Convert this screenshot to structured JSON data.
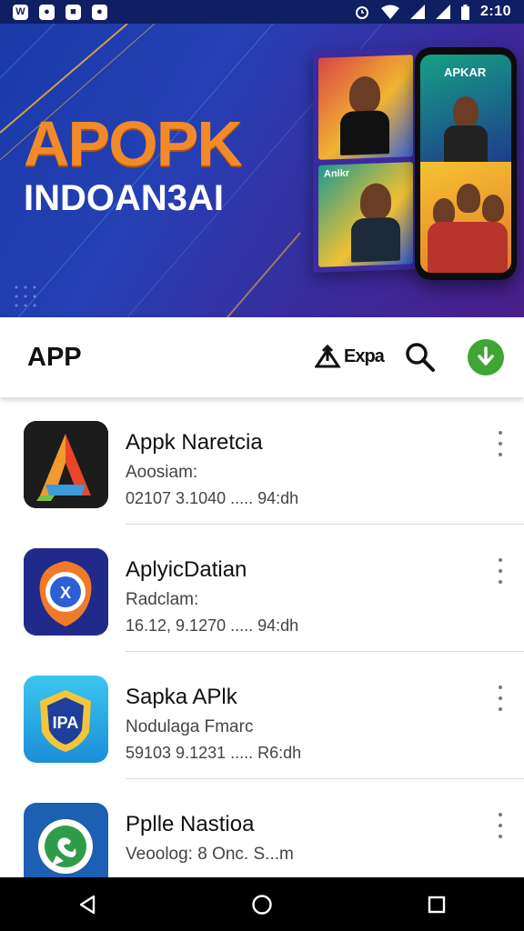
{
  "status_bar": {
    "notification_icons": [
      "W",
      "",
      "",
      ""
    ],
    "time": "2:10",
    "icons": [
      "alarm-icon",
      "wifi-icon",
      "signal-icon",
      "signal-icon",
      "battery-icon"
    ]
  },
  "banner": {
    "title_line1": "APOPK",
    "title_line2": "INDOAN3AI",
    "phone_label": "APKAR",
    "card_label": "Anlkr"
  },
  "app_bar": {
    "title": "APP",
    "action_label": "Expa",
    "accent_color": "#3fa535"
  },
  "apps": [
    {
      "name": "Appk Naretcia",
      "subtitle": "Aoosiam:",
      "meta": "02107 3.1040 ..... 94:dh",
      "icon": "letter-a-logo-icon"
    },
    {
      "name": "AplyicDatian",
      "subtitle": "Radclam:",
      "meta": "16.12, 9.1270 ..... 94:dh",
      "icon": "shield-ball-logo-icon"
    },
    {
      "name": "Sapka APlk",
      "subtitle": "Nodulaga Fmarc",
      "meta": "59103 9.1231 ..... R6:dh",
      "icon": "ipa-badge-logo-icon"
    },
    {
      "name": "Pplle Nastioa",
      "subtitle": "Veoolog: 8 Onc. S...m",
      "meta": "",
      "icon": "chat-bubble-logo-icon"
    }
  ],
  "nav_bar": {
    "buttons": [
      "back",
      "home",
      "recents"
    ]
  }
}
